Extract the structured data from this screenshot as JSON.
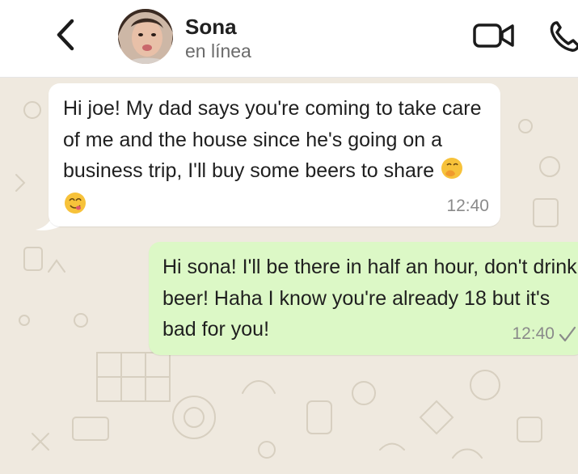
{
  "header": {
    "contact_name": "Sona",
    "contact_status": "en línea",
    "icons": [
      "back-arrow-icon",
      "video-call-icon",
      "phone-icon"
    ]
  },
  "messages": [
    {
      "direction": "incoming",
      "text": "Hi joe! My dad says you're coming to take care of me and the house since he's going on a business trip, I'll buy some beers to share",
      "emojis": [
        "hand-over-mouth-emoji",
        "savoring-food-emoji"
      ],
      "time": "12:40"
    },
    {
      "direction": "outgoing",
      "text": "Hi sona! I'll be there in half an hour, don't drink beer! Haha I know you're already 18 but it's bad for you!",
      "time": "12:40",
      "status_icon": "single-check-icon"
    }
  ],
  "colors": {
    "incoming_bubble": "#ffffff",
    "outgoing_bubble": "#dcf8c6",
    "chat_background": "#efe9df",
    "header_background": "#ffffff",
    "time_text": "#8a8a8a"
  }
}
